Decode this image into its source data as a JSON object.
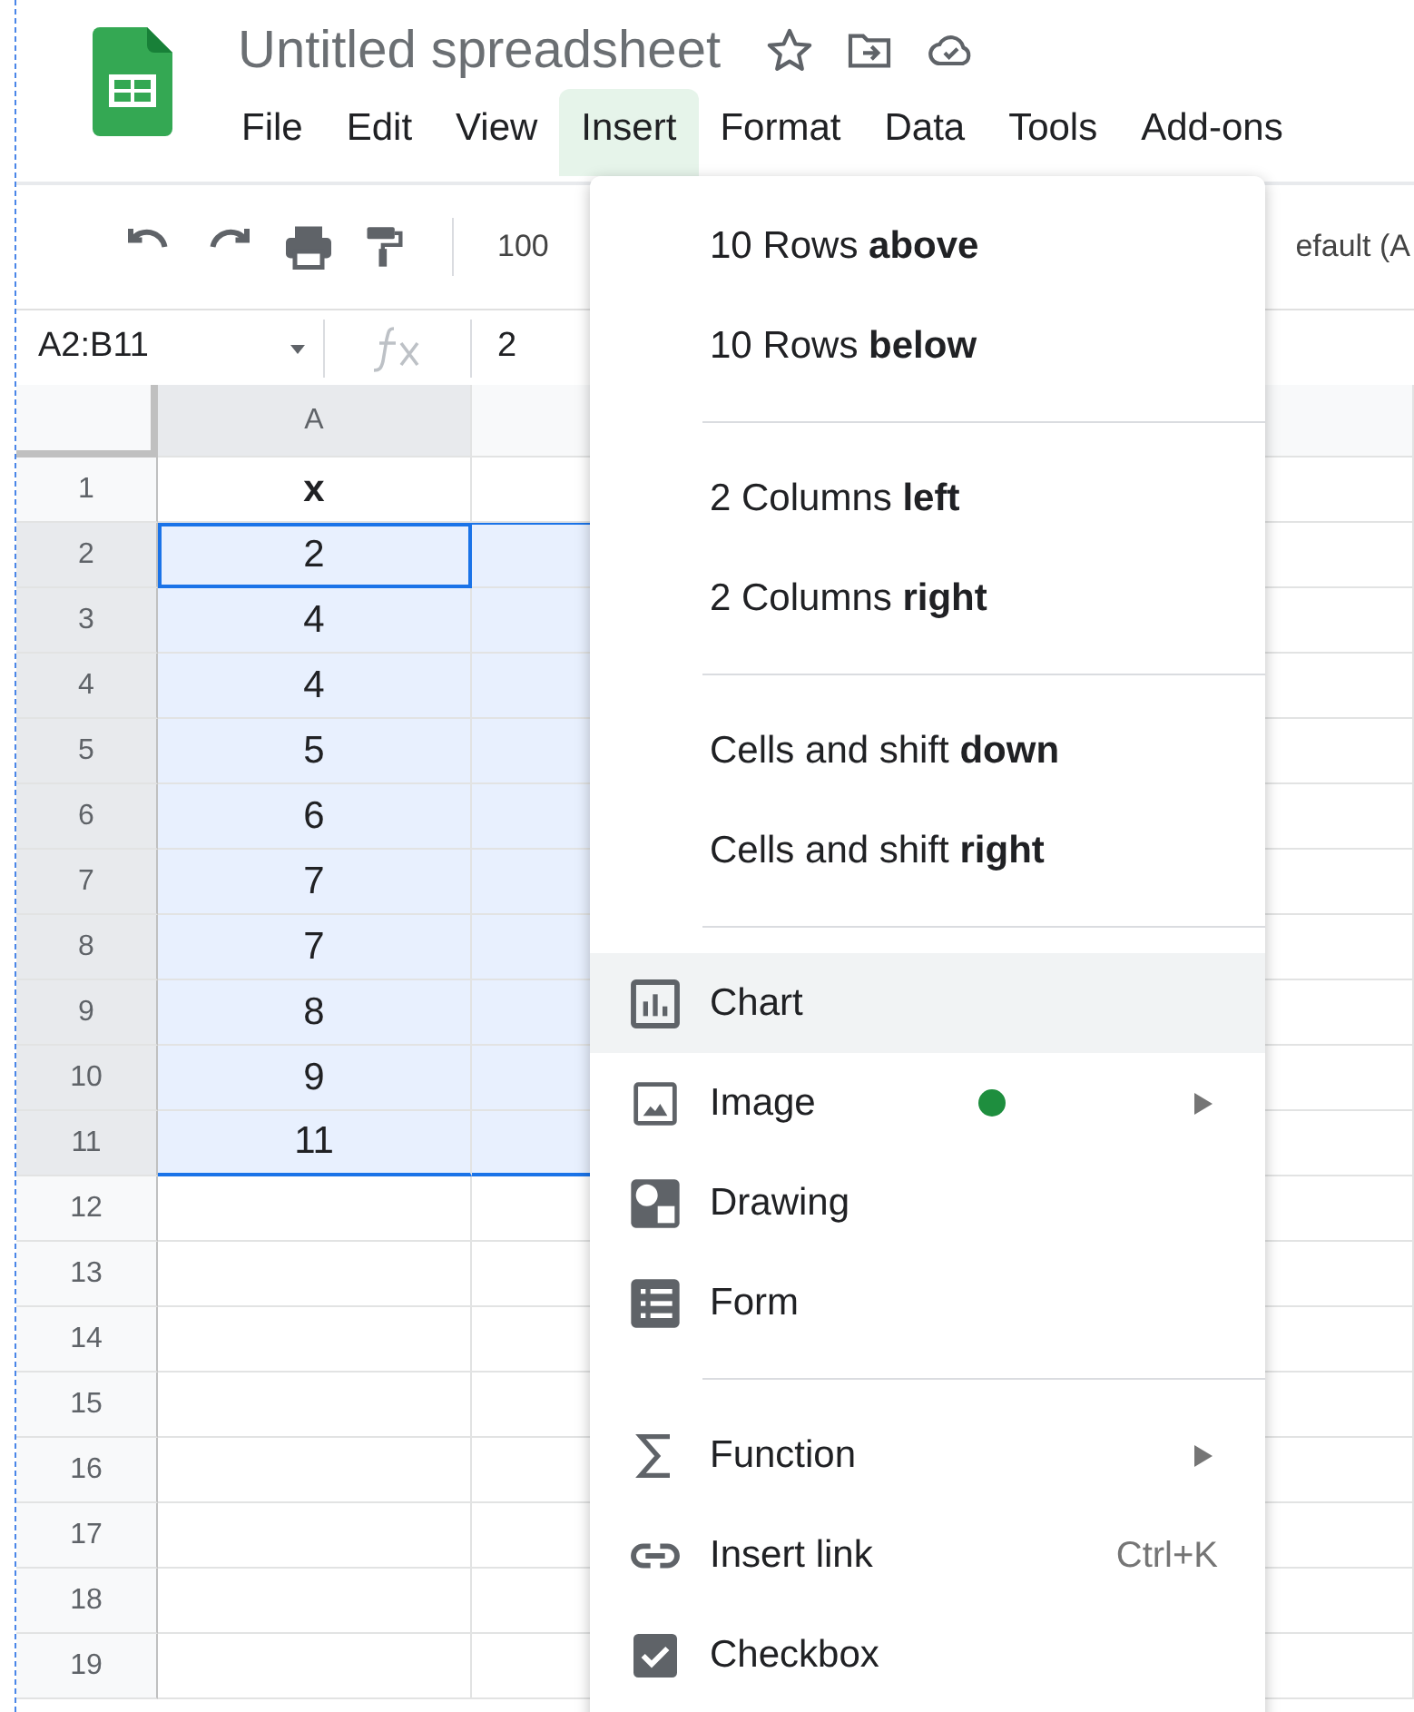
{
  "app": {
    "title": "Untitled spreadsheet"
  },
  "menubar": [
    {
      "label": "File",
      "selected": false
    },
    {
      "label": "Edit",
      "selected": false
    },
    {
      "label": "View",
      "selected": false
    },
    {
      "label": "Insert",
      "selected": true
    },
    {
      "label": "Format",
      "selected": false
    },
    {
      "label": "Data",
      "selected": false
    },
    {
      "label": "Tools",
      "selected": false
    },
    {
      "label": "Add-ons",
      "selected": false
    }
  ],
  "toolbar": {
    "zoom": "100",
    "font": "efault (A"
  },
  "formula_bar": {
    "name_box": "A2:B11",
    "value": "2"
  },
  "sheet": {
    "columns": [
      "A"
    ],
    "rows": [
      {
        "number": "1",
        "cells": [
          "x"
        ],
        "kind": "header",
        "selected": false,
        "active": false
      },
      {
        "number": "2",
        "cells": [
          "2"
        ],
        "kind": "data",
        "selected": true,
        "active": true
      },
      {
        "number": "3",
        "cells": [
          "4"
        ],
        "kind": "data",
        "selected": true,
        "active": false
      },
      {
        "number": "4",
        "cells": [
          "4"
        ],
        "kind": "data",
        "selected": true,
        "active": false
      },
      {
        "number": "5",
        "cells": [
          "5"
        ],
        "kind": "data",
        "selected": true,
        "active": false
      },
      {
        "number": "6",
        "cells": [
          "6"
        ],
        "kind": "data",
        "selected": true,
        "active": false
      },
      {
        "number": "7",
        "cells": [
          "7"
        ],
        "kind": "data",
        "selected": true,
        "active": false
      },
      {
        "number": "8",
        "cells": [
          "7"
        ],
        "kind": "data",
        "selected": true,
        "active": false
      },
      {
        "number": "9",
        "cells": [
          "8"
        ],
        "kind": "data",
        "selected": true,
        "active": false
      },
      {
        "number": "10",
        "cells": [
          "9"
        ],
        "kind": "data",
        "selected": true,
        "active": false
      },
      {
        "number": "11",
        "cells": [
          "11"
        ],
        "kind": "data",
        "selected": true,
        "active": false
      },
      {
        "number": "12",
        "cells": [],
        "selected": false,
        "active": false
      },
      {
        "number": "13",
        "cells": [],
        "selected": false,
        "active": false
      },
      {
        "number": "14",
        "cells": [],
        "selected": false,
        "active": false
      },
      {
        "number": "15",
        "cells": [],
        "selected": false,
        "active": false
      },
      {
        "number": "16",
        "cells": [],
        "selected": false,
        "active": false
      },
      {
        "number": "17",
        "cells": [],
        "selected": false,
        "active": false
      },
      {
        "number": "18",
        "cells": [],
        "selected": false,
        "active": false
      },
      {
        "number": "19",
        "cells": [],
        "selected": false,
        "active": false
      }
    ]
  },
  "insert_menu": {
    "sections": [
      [
        {
          "label": "10 Rows **above**",
          "selected": false
        },
        {
          "label": "10 Rows **below**",
          "selected": false
        }
      ],
      [
        {
          "label": "2 Columns **left**",
          "selected": false
        },
        {
          "label": "2 Columns **right**",
          "selected": false
        }
      ],
      [
        {
          "label": "Cells and shift **down**",
          "selected": false
        },
        {
          "label": "Cells and shift **right**",
          "selected": false
        }
      ],
      [
        {
          "label": "Chart",
          "kind": "chart",
          "selected": true
        },
        {
          "label": "Image",
          "kind": "image",
          "dot": true,
          "submenu": true,
          "selected": false
        },
        {
          "label": "Drawing",
          "kind": "drawing",
          "selected": false
        },
        {
          "label": "Form",
          "kind": "form",
          "selected": false
        }
      ],
      [
        {
          "label": "Function",
          "kind": "function",
          "submenu": true,
          "selected": false
        },
        {
          "label": "Insert link",
          "kind": "link",
          "shortcut": "Ctrl+K",
          "selected": false
        },
        {
          "label": "Checkbox",
          "kind": "checkbox",
          "selected": false
        }
      ]
    ]
  }
}
